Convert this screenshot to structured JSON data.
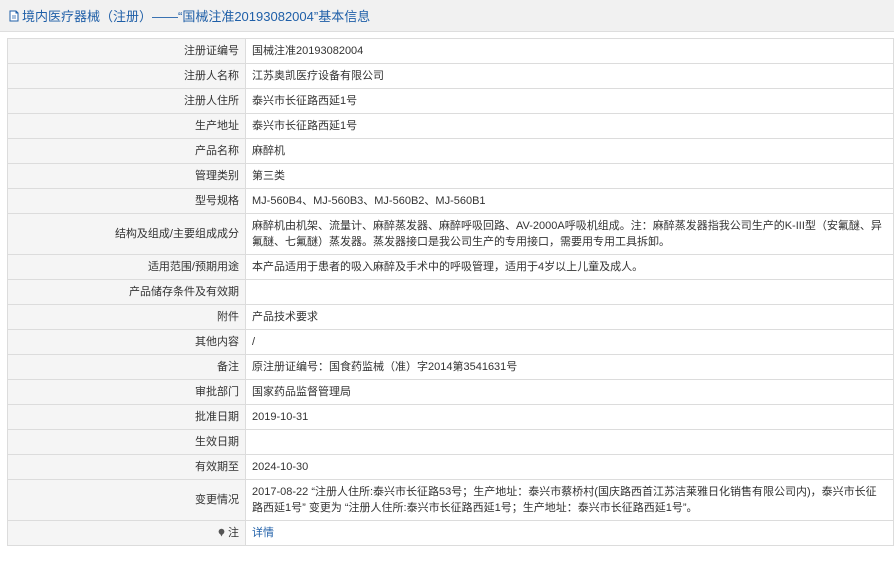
{
  "header": {
    "title": "境内医疗器械（注册）——“国械注准20193082004”基本信息",
    "icon": "document-icon",
    "color": "#1f5fa8"
  },
  "rows": [
    {
      "label": "注册证编号",
      "value": "国械注准20193082004"
    },
    {
      "label": "注册人名称",
      "value": "江苏奥凯医疗设备有限公司"
    },
    {
      "label": "注册人住所",
      "value": "泰兴市长征路西延1号"
    },
    {
      "label": "生产地址",
      "value": "泰兴市长征路西延1号"
    },
    {
      "label": "产品名称",
      "value": "麻醉机"
    },
    {
      "label": "管理类别",
      "value": "第三类"
    },
    {
      "label": "型号规格",
      "value": "MJ-560B4、MJ-560B3、MJ-560B2、MJ-560B1"
    },
    {
      "label": "结构及组成/主要组成成分",
      "value": "麻醉机由机架、流量计、麻醉蒸发器、麻醉呼吸回路、AV-2000A呼吸机组成。注：麻醉蒸发器指我公司生产的K-III型（安氟醚、异氟醚、七氟醚）蒸发器。蒸发器接口是我公司生产的专用接口，需要用专用工具拆卸。"
    },
    {
      "label": "适用范围/预期用途",
      "value": "本产品适用于患者的吸入麻醉及手术中的呼吸管理，适用于4岁以上儿童及成人。"
    },
    {
      "label": "产品储存条件及有效期",
      "value": ""
    },
    {
      "label": "附件",
      "value": "产品技术要求"
    },
    {
      "label": "其他内容",
      "value": "/"
    },
    {
      "label": "备注",
      "value": "原注册证编号：国食药监械（准）字2014第3541631号"
    },
    {
      "label": "审批部门",
      "value": "国家药品监督管理局"
    },
    {
      "label": "批准日期",
      "value": "2019-10-31"
    },
    {
      "label": "生效日期",
      "value": ""
    },
    {
      "label": "有效期至",
      "value": "2024-10-30"
    },
    {
      "label": "变更情况",
      "value": "2017-08-22 “注册人住所:泰兴市长征路53号；生产地址：泰兴市蔡桥村(国庆路西首江苏洁莱雅日化销售有限公司内)，泰兴市长征路西延1号” 变更为 “注册人住所:泰兴市长征路西延1号；生产地址：泰兴市长征路西延1号”。"
    },
    {
      "label": "注",
      "value": "详情",
      "icon": "pin-icon"
    }
  ]
}
